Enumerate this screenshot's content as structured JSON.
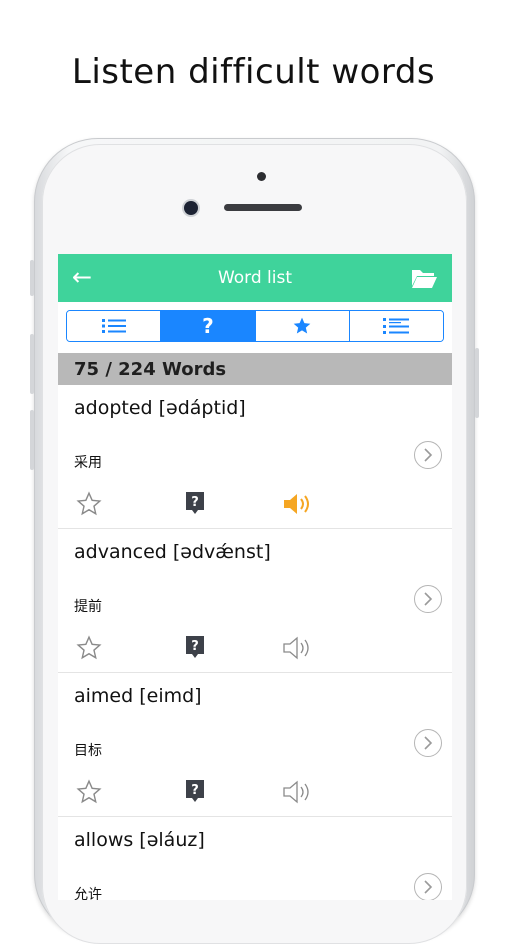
{
  "promo": {
    "title": "Listen difficult words"
  },
  "header": {
    "title": "Word list",
    "back_icon": "back-arrow-icon",
    "folder_icon": "folder-open-icon"
  },
  "tabs": [
    {
      "id": "list",
      "icon": "list-icon",
      "active": false
    },
    {
      "id": "question",
      "label": "?",
      "icon": "question-icon",
      "active": true
    },
    {
      "id": "star",
      "icon": "star-icon",
      "active": false
    },
    {
      "id": "detail-list",
      "icon": "detail-list-icon",
      "active": false
    }
  ],
  "count": {
    "text": "75 / 224 Words"
  },
  "words": [
    {
      "headword": "adopted [ədáptid]",
      "meaning": "采用",
      "speaker_active": true
    },
    {
      "headword": "advanced [ədvǽnst]",
      "meaning": "提前",
      "speaker_active": false
    },
    {
      "headword": "aimed [eimd]",
      "meaning": "目标",
      "speaker_active": false
    },
    {
      "headword": "allows [əláuz]",
      "meaning": "允许",
      "speaker_active": false
    }
  ],
  "colors": {
    "accent": "#3fd39b",
    "segment": "#1a86ff",
    "speaker_active": "#f5a623",
    "count_bar": "#b8b8b8"
  }
}
